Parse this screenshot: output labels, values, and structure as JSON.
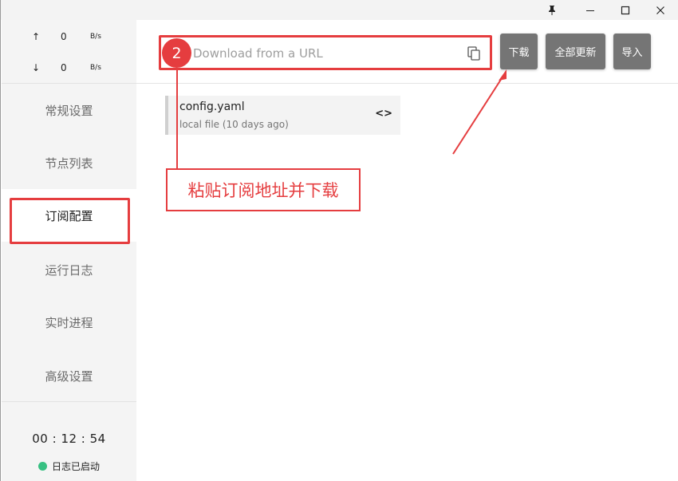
{
  "titlebar": {
    "pin_icon": "pin-icon",
    "minimize_icon": "minimize-icon",
    "maximize_icon": "maximize-icon",
    "close_icon": "close-icon"
  },
  "traffic": {
    "up": {
      "arrow": "↑",
      "value": "0",
      "unit": "B/s"
    },
    "down": {
      "arrow": "↓",
      "value": "0",
      "unit": "B/s"
    }
  },
  "sidebar": {
    "items": [
      {
        "label": "常规设置"
      },
      {
        "label": "节点列表"
      },
      {
        "label": "订阅配置"
      },
      {
        "label": "运行日志"
      },
      {
        "label": "实时进程"
      },
      {
        "label": "高级设置"
      }
    ],
    "active_index": 2,
    "clock": "00 : 12 : 54",
    "status": {
      "text": "日志已启动",
      "color": "#37c082"
    }
  },
  "toolbar": {
    "url_placeholder": "Download from a URL",
    "paste_icon": "paste-icon",
    "download_label": "下载",
    "update_all_label": "全部更新",
    "import_label": "导入"
  },
  "profiles": [
    {
      "name": "config.yaml",
      "meta": "local file (10 days ago)",
      "edit_glyph": "<>"
    }
  ],
  "annotations": {
    "step_number": "2",
    "callout_text": "粘贴订阅地址并下载",
    "accent_color": "#e53d3f"
  }
}
